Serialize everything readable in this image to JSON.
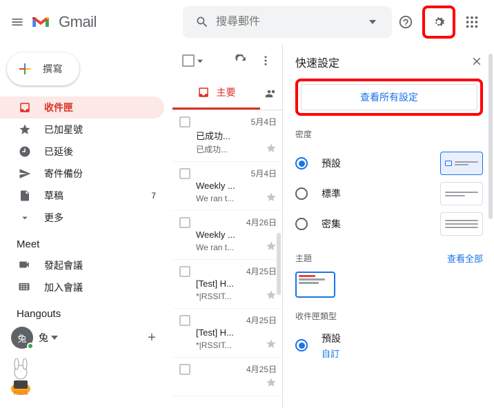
{
  "header": {
    "brand": "Gmail",
    "search_placeholder": "搜尋郵件"
  },
  "compose_label": "撰寫",
  "nav": [
    {
      "label": "收件匣",
      "icon": "inbox"
    },
    {
      "label": "已加星號",
      "icon": "star"
    },
    {
      "label": "已延後",
      "icon": "clock"
    },
    {
      "label": "寄件備份",
      "icon": "sent"
    },
    {
      "label": "草稿",
      "icon": "draft",
      "count": "7"
    },
    {
      "label": "更多",
      "icon": "more"
    }
  ],
  "meet": {
    "title": "Meet",
    "items": [
      {
        "label": "發起會議"
      },
      {
        "label": "加入會議"
      }
    ]
  },
  "hangouts": {
    "title": "Hangouts",
    "user_short": "兔",
    "user_name": "兔"
  },
  "tab_primary": "主要",
  "mails": [
    {
      "date": "5月4日",
      "subject": "已成功...",
      "snippet": "已成功..."
    },
    {
      "date": "5月4日",
      "subject": "Weekly ...",
      "snippet": "We ran t..."
    },
    {
      "date": "4月26日",
      "subject": "Weekly ...",
      "snippet": "We ran t..."
    },
    {
      "date": "4月25日",
      "subject": "[Test] H...",
      "snippet": "*|RSSIT..."
    },
    {
      "date": "4月25日",
      "subject": "[Test] H...",
      "snippet": "*|RSSIT..."
    },
    {
      "date": "4月25日",
      "subject": "",
      "snippet": ""
    }
  ],
  "panel": {
    "title": "快速設定",
    "all_settings": "查看所有設定",
    "density": {
      "title": "密度",
      "options": [
        "預設",
        "標準",
        "密集"
      ]
    },
    "theme": {
      "title": "主題",
      "view_all": "查看全部"
    },
    "inbox_type": {
      "title": "收件匣類型",
      "option": "預設",
      "custom": "自訂"
    }
  }
}
